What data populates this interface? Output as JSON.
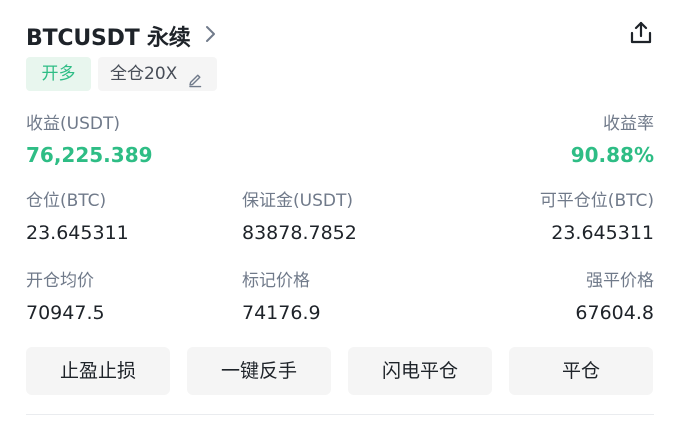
{
  "header": {
    "title": "BTCUSDT 永续",
    "icons": {
      "chevron": "chevron-right-icon",
      "share": "share-icon"
    }
  },
  "tags": {
    "side": "开多",
    "margin": "全仓20X",
    "edit_icon": "pencil-icon"
  },
  "pnl": {
    "label": "收益(USDT)",
    "value": "76,225.389",
    "rate_label": "收益率",
    "rate_value": "90.88%"
  },
  "row1": {
    "position_label": "仓位(BTC)",
    "position_value": "23.645311",
    "margin_label": "保证金(USDT)",
    "margin_value": "83878.7852",
    "closable_label": "可平仓位(BTC)",
    "closable_value": "23.645311"
  },
  "row2": {
    "entry_label": "开仓均价",
    "entry_value": "70947.5",
    "mark_label": "标记价格",
    "mark_value": "74176.9",
    "liq_label": "强平价格",
    "liq_value": "67604.8"
  },
  "buttons": {
    "tp_sl": "止盈止损",
    "reverse": "一键反手",
    "flash_close": "闪电平仓",
    "close": "平仓"
  },
  "colors": {
    "green": "#2ebd85",
    "text": "#1e2329",
    "muted": "#707a8a",
    "button_bg": "#f5f5f5"
  }
}
